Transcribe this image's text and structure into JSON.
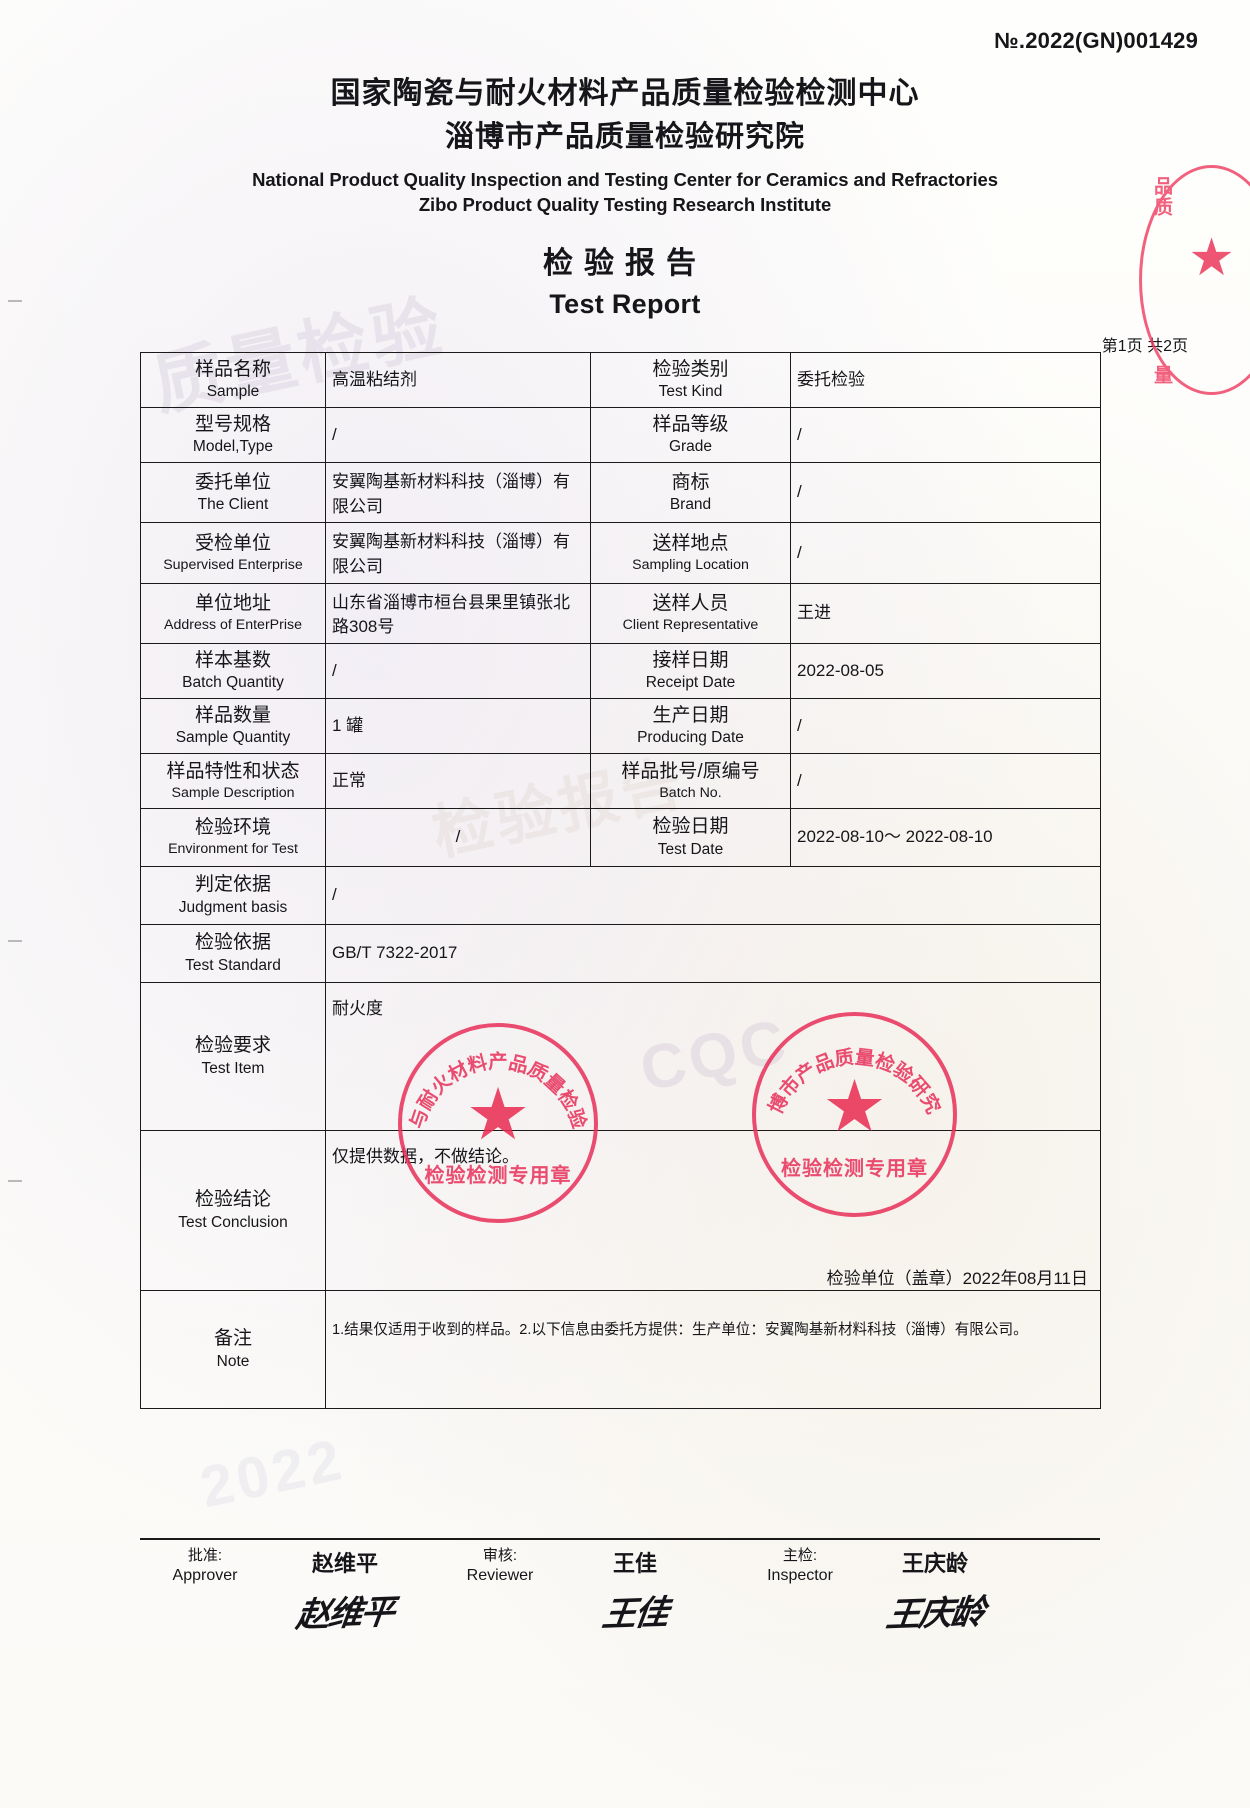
{
  "report_no": "№.2022(GN)001429",
  "header": {
    "title_cn_1": "国家陶瓷与耐火材料产品质量检验检测中心",
    "title_cn_2": "淄博市产品质量检验研究院",
    "title_en_1": "National Product Quality Inspection and Testing Center for Ceramics and Refractories",
    "title_en_2": "Zibo Product Quality Testing Research Institute",
    "doc_title_cn": "检验报告",
    "doc_title_en": "Test Report",
    "page_indicator": "第1页 共2页"
  },
  "rows": [
    {
      "label_cn": "样品名称",
      "label_en": "Sample",
      "value": "高温粘结剂",
      "label2_cn": "检验类别",
      "label2_en": "Test Kind",
      "value2": "委托检验"
    },
    {
      "label_cn": "型号规格",
      "label_en": "Model,Type",
      "value": "/",
      "label2_cn": "样品等级",
      "label2_en": "Grade",
      "value2": "/"
    },
    {
      "label_cn": "委托单位",
      "label_en": "The Client",
      "value": "安翼陶基新材料科技（淄博）有限公司",
      "label2_cn": "商标",
      "label2_en": "Brand",
      "value2": "/"
    },
    {
      "label_cn": "受检单位",
      "label_en": "Supervised Enterprise",
      "value": "安翼陶基新材料科技（淄博）有限公司",
      "label2_cn": "送样地点",
      "label2_en": "Sampling Location",
      "value2": "/"
    },
    {
      "label_cn": "单位地址",
      "label_en": "Address of EnterPrise",
      "value": "山东省淄博市桓台县果里镇张北路308号",
      "label2_cn": "送样人员",
      "label2_en": "Client Representative",
      "value2": "王进"
    },
    {
      "label_cn": "样本基数",
      "label_en": "Batch Quantity",
      "value": "/",
      "label2_cn": "接样日期",
      "label2_en": "Receipt Date",
      "value2": "2022-08-05"
    },
    {
      "label_cn": "样品数量",
      "label_en": "Sample Quantity",
      "value": "1 罐",
      "label2_cn": "生产日期",
      "label2_en": "Producing Date",
      "value2": "/"
    },
    {
      "label_cn": "样品特性和状态",
      "label_en": "Sample Description",
      "value": "正常",
      "label2_cn": "样品批号/原编号",
      "label2_en": "Batch No.",
      "value2": "/"
    },
    {
      "label_cn": "检验环境",
      "label_en": "Environment for Test",
      "value": "/",
      "label2_cn": "检验日期",
      "label2_en": "Test Date",
      "value2": "2022-08-10～ 2022-08-10"
    }
  ],
  "full_rows": {
    "judgment": {
      "label_cn": "判定依据",
      "label_en": "Judgment basis",
      "value": "/"
    },
    "standard": {
      "label_cn": "检验依据",
      "label_en": "Test Standard",
      "value": "GB/T 7322-2017"
    },
    "test_item": {
      "label_cn": "检验要求",
      "label_en": "Test Item",
      "value": "耐火度"
    },
    "conclusion": {
      "label_cn": "检验结论",
      "label_en": "Test Conclusion",
      "value": "仅提供数据，不做结论。",
      "stamp_line": "检验单位（盖章）2022年08月11日"
    },
    "note": {
      "label_cn": "备注",
      "label_en": "Note",
      "value": "1.结果仅适用于收到的样品。2.以下信息由委托方提供：生产单位：安翼陶基新材料科技（淄博）有限公司。"
    }
  },
  "signatures": [
    {
      "label_cn": "批准:",
      "label_en": "Approver",
      "name": "赵维平",
      "signature": "赵维平"
    },
    {
      "label_cn": "审核:",
      "label_en": "Reviewer",
      "name": "王佳",
      "signature": "王佳"
    },
    {
      "label_cn": "主检:",
      "label_en": "Inspector",
      "name": "王庆龄",
      "signature": "王庆龄"
    }
  ],
  "seals": {
    "left_bottom_text": "检验检测专用章",
    "left_arc_text": "国家陶瓷与耐火材料产品质量检验检测中心",
    "right_bottom_text": "检验检测专用章",
    "right_arc_text": "淄博市产品质量检验研究院",
    "corner_text_top": "品质",
    "corner_text_bottom": "量",
    "color": "#e8315a"
  },
  "watermarks": {
    "w1": "质量检验",
    "w2": "CQC",
    "w3": "2022",
    "w4": "检验报告"
  }
}
